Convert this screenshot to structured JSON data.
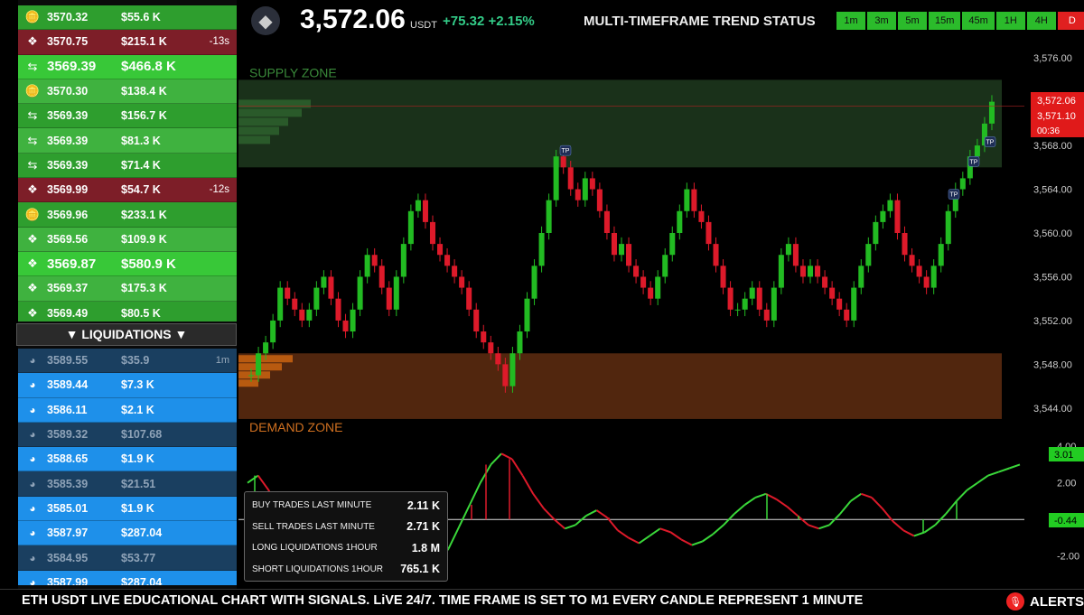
{
  "trades": [
    {
      "side": "buy",
      "icon": "coin-icon",
      "price": "3570.32",
      "value": "$55.6 K",
      "time": "",
      "size": "normal"
    },
    {
      "side": "sell",
      "icon": "diamond-icon",
      "price": "3570.75",
      "value": "$215.1 K",
      "time": "-13s",
      "size": "normal"
    },
    {
      "side": "buy",
      "icon": "swap-icon",
      "price": "3569.39",
      "value": "$466.8 K",
      "time": "",
      "size": "big"
    },
    {
      "side": "buy",
      "icon": "coin-icon",
      "price": "3570.30",
      "value": "$138.4 K",
      "time": "",
      "size": "normal"
    },
    {
      "side": "buy",
      "icon": "swap-icon",
      "price": "3569.39",
      "value": "$156.7 K",
      "time": "",
      "size": "normal"
    },
    {
      "side": "buy",
      "icon": "swap-icon",
      "price": "3569.39",
      "value": "$81.3 K",
      "time": "",
      "size": "normal"
    },
    {
      "side": "buy",
      "icon": "swap-icon",
      "price": "3569.39",
      "value": "$71.4 K",
      "time": "",
      "size": "normal"
    },
    {
      "side": "sell",
      "icon": "diamond-icon",
      "price": "3569.99",
      "value": "$54.7 K",
      "time": "-12s",
      "size": "normal"
    },
    {
      "side": "buy",
      "icon": "coin-icon",
      "price": "3569.96",
      "value": "$233.1 K",
      "time": "",
      "size": "normal"
    },
    {
      "side": "buy",
      "icon": "diamond-icon",
      "price": "3569.56",
      "value": "$109.9 K",
      "time": "",
      "size": "normal"
    },
    {
      "side": "buy",
      "icon": "diamond-icon",
      "price": "3569.87",
      "value": "$580.9 K",
      "time": "",
      "size": "big"
    },
    {
      "side": "buy",
      "icon": "diamond-icon",
      "price": "3569.37",
      "value": "$175.3 K",
      "time": "",
      "size": "normal"
    },
    {
      "side": "buy",
      "icon": "diamond-icon",
      "price": "3569.49",
      "value": "$80.5 K",
      "time": "",
      "size": "normal"
    }
  ],
  "liquidations_header": "▼ LIQUIDATIONS ▼",
  "liquidations": [
    {
      "level": "lo",
      "price": "3589.55",
      "value": "$35.9",
      "time": "1m"
    },
    {
      "level": "hi",
      "price": "3589.44",
      "value": "$7.3 K",
      "time": ""
    },
    {
      "level": "hi",
      "price": "3586.11",
      "value": "$2.1 K",
      "time": ""
    },
    {
      "level": "lo",
      "price": "3589.32",
      "value": "$107.68",
      "time": ""
    },
    {
      "level": "hi",
      "price": "3588.65",
      "value": "$1.9 K",
      "time": ""
    },
    {
      "level": "lo",
      "price": "3585.39",
      "value": "$21.51",
      "time": ""
    },
    {
      "level": "hi",
      "price": "3585.01",
      "value": "$1.9 K",
      "time": ""
    },
    {
      "level": "hi",
      "price": "3587.97",
      "value": "$287.04",
      "time": ""
    },
    {
      "level": "lo",
      "price": "3584.95",
      "value": "$53.77",
      "time": ""
    },
    {
      "level": "hi",
      "price": "3587.99",
      "value": "$287.04",
      "time": ""
    }
  ],
  "header": {
    "price": "3,572.06",
    "unit": "USDT",
    "change": "+75.32 +2.15%",
    "mtf_title": "MULTI-TIMEFRAME TREND STATUS",
    "timeframes": [
      {
        "label": "1m",
        "state": "up"
      },
      {
        "label": "3m",
        "state": "up"
      },
      {
        "label": "5m",
        "state": "up"
      },
      {
        "label": "15m",
        "state": "up"
      },
      {
        "label": "45m",
        "state": "up"
      },
      {
        "label": "1H",
        "state": "up"
      },
      {
        "label": "4H",
        "state": "up"
      },
      {
        "label": "D",
        "state": "down"
      }
    ]
  },
  "zones": {
    "supply": "SUPPLY ZONE",
    "demand": "DEMAND ZONE"
  },
  "tp_label": "TP",
  "price_tags": {
    "last": "3,572.06",
    "prev": "3,571.10",
    "countdown": "00:36"
  },
  "osc_tags": {
    "top": "3.01",
    "bottom": "-0.44"
  },
  "stats": [
    {
      "label": "BUY TRADES LAST MINUTE",
      "value": "2.11 K"
    },
    {
      "label": "SELL TRADES LAST MINUTE",
      "value": "2.71 K"
    },
    {
      "label": "LONG LIQUIDATIONS 1HOUR",
      "value": "1.8 M"
    },
    {
      "label": "SHORT LIQUIDATIONS 1HOUR",
      "value": "765.1 K"
    }
  ],
  "ticker": "ETH USDT  LIVE EDUCATIONAL CHART WITH SIGNALS. LiVE 24/7.   TIME FRAME IS SET TO M1  EVERY CANDLE REPRESENT 1 MINUTE",
  "alerts_label": "ALERTS",
  "colors": {
    "up": "#22bb22",
    "down": "#dd1a2a",
    "supply": "#1f3a1f",
    "demand": "#5a2a10",
    "accent": "#2bbb2b"
  },
  "chart_data": {
    "type": "candlestick",
    "price_axis": {
      "ticks": [
        "3,576.00",
        "3,572.00",
        "3,568.00",
        "3,564.00",
        "3,560.00",
        "3,556.00",
        "3,552.00",
        "3,548.00",
        "3,544.00"
      ],
      "range": [
        3542.5,
        3577.5
      ]
    },
    "supply_zone": [
      3566.0,
      3574.0
    ],
    "demand_zone": [
      3543.0,
      3549.0
    ],
    "close_path": [
      3547,
      3549,
      3550,
      3552,
      3555,
      3554,
      3553,
      3552,
      3553,
      3555,
      3556,
      3554,
      3552,
      3551,
      3553,
      3556,
      3558,
      3557,
      3555,
      3553,
      3556,
      3559,
      3562,
      3563,
      3561,
      3559,
      3558,
      3557,
      3556,
      3555,
      3553,
      3551,
      3550,
      3549,
      3548,
      3546,
      3549,
      3551,
      3554,
      3557,
      3560,
      3563,
      3567,
      3566,
      3564,
      3563,
      3565,
      3564,
      3562,
      3560,
      3558,
      3559,
      3557,
      3556,
      3555,
      3554,
      3556,
      3558,
      3560,
      3562,
      3564,
      3562,
      3561,
      3559,
      3557,
      3555,
      3553,
      3553,
      3554,
      3555,
      3553,
      3552,
      3555,
      3558,
      3559,
      3557,
      3556,
      3557,
      3556,
      3555,
      3554,
      3553,
      3552,
      3555,
      3557,
      3559,
      3561,
      3562,
      3563,
      3560,
      3558,
      3557,
      3556,
      3555,
      3557,
      3559,
      3562,
      3564,
      3565,
      3567,
      3568,
      3570,
      3572
    ],
    "oscillator": {
      "ticks": [
        "4.00",
        "2.00",
        "0.00",
        "-2.00"
      ],
      "range": [
        -3.2,
        4.8
      ],
      "values": [
        2.0,
        2.4,
        1.6,
        0.2,
        -0.9,
        -1.3,
        -1.0,
        -0.4,
        0.3,
        0.8,
        1.1,
        0.9,
        0.3,
        -0.4,
        -1.1,
        -1.7,
        -2.1,
        -2.3,
        -2.4,
        -1.6,
        -0.4,
        0.8,
        2.0,
        3.0,
        3.6,
        3.3,
        2.4,
        1.4,
        0.6,
        0.0,
        -0.5,
        -0.3,
        0.2,
        0.5,
        0.1,
        -0.6,
        -1.0,
        -1.3,
        -0.9,
        -0.5,
        -0.7,
        -1.1,
        -1.4,
        -1.2,
        -0.8,
        -0.3,
        0.3,
        0.8,
        1.2,
        1.4,
        1.1,
        0.7,
        0.2,
        -0.3,
        -0.5,
        -0.3,
        0.3,
        1.0,
        1.4,
        1.2,
        0.6,
        -0.1,
        -0.6,
        -0.9,
        -0.7,
        -0.3,
        0.3,
        1.0,
        1.6,
        2.0,
        2.4,
        2.6,
        2.8,
        3.0
      ]
    }
  }
}
